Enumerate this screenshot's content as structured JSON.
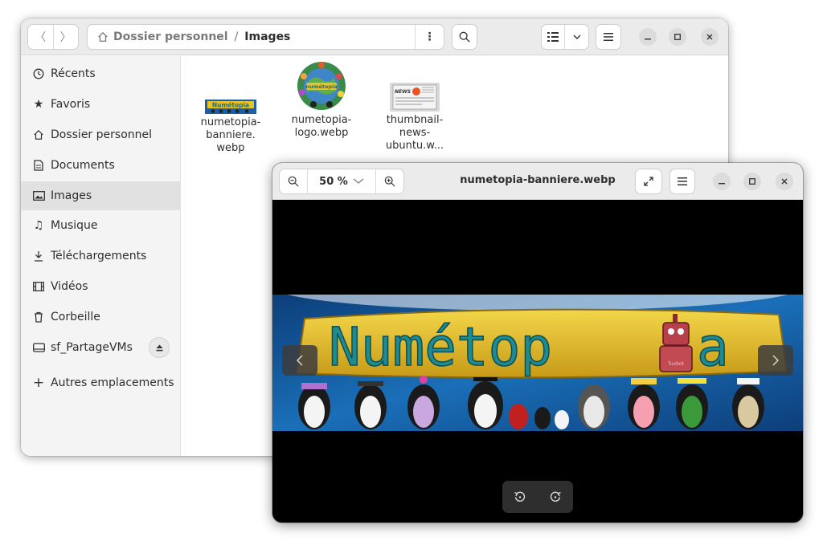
{
  "file_manager": {
    "path": {
      "parent": "Dossier personnel",
      "separator": "/",
      "current": "Images"
    },
    "sidebar": [
      {
        "label": "Récents",
        "icon": "clock-icon"
      },
      {
        "label": "Favoris",
        "icon": "star-icon"
      },
      {
        "label": "Dossier personnel",
        "icon": "home-icon"
      },
      {
        "label": "Documents",
        "icon": "document-icon"
      },
      {
        "label": "Images",
        "icon": "image-icon",
        "active": true
      },
      {
        "label": "Musique",
        "icon": "music-icon"
      },
      {
        "label": "Téléchargements",
        "icon": "download-icon"
      },
      {
        "label": "Vidéos",
        "icon": "video-icon"
      },
      {
        "label": "Corbeille",
        "icon": "trash-icon"
      },
      {
        "label": "sf_PartageVMs",
        "icon": "drive-icon"
      },
      {
        "label": "Autres emplacements",
        "icon": "plus-icon"
      }
    ],
    "files": [
      {
        "label_lines": [
          "numetopia-",
          "banniere.",
          "webp"
        ],
        "thumb_text": "Numétopia"
      },
      {
        "label_lines": [
          "numetopia-",
          "logo.webp"
        ],
        "thumb_text": "numétopia"
      },
      {
        "label_lines": [
          "thumbnail-",
          "news-",
          "ubuntu.w..."
        ],
        "thumb_text": "NEWS"
      }
    ]
  },
  "image_viewer": {
    "title": "numetopia-banniere.webp",
    "zoom": "50 %",
    "banner_text": "Numétop",
    "banner_text_end": "a",
    "robot_label": "Tuxbot"
  },
  "colors": {
    "banner_yellow": "#e7c22a",
    "banner_text": "#1f8a8f",
    "banner_sky": "#1a5fa8",
    "header_bg": "#ebebeb"
  }
}
